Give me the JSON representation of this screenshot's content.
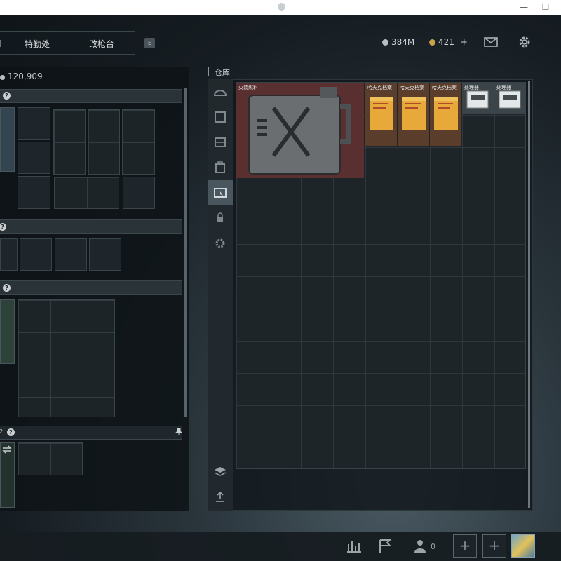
{
  "window": {
    "minimize_glyph": "—",
    "maximize_glyph": "☐"
  },
  "nav": {
    "tabs": [
      "特勤处",
      "改枪台"
    ],
    "hotkey": "E"
  },
  "header": {
    "silver": "384M",
    "gold": "421",
    "gold_add": "+",
    "icons": [
      "mail-icon",
      "gear-icon"
    ],
    "colors": {
      "silver": "#b9bec1",
      "gold": "#c9a24a"
    }
  },
  "loadout": {
    "money": "120,909",
    "help_glyph": "?",
    "last_section_prefix": "2",
    "pin_glyph": "📌"
  },
  "stash": {
    "title": "仓库",
    "items": [
      {
        "label": "火箭燃料",
        "kind": "jerrycan",
        "bg": "#5a2f2f"
      },
      {
        "label": "哈夫克档案",
        "kind": "folder",
        "bg": "#5b3d2c"
      },
      {
        "label": "哈夫克档案",
        "kind": "folder",
        "bg": "#5b3d2c"
      },
      {
        "label": "哈夫克档案",
        "kind": "folder",
        "bg": "#5b3d2c"
      },
      {
        "label": "处理器",
        "kind": "processor",
        "bg": "#3b4449"
      },
      {
        "label": "处理器",
        "kind": "processor",
        "bg": "#3b4449"
      }
    ],
    "sidebar_icons": [
      "helmet-icon",
      "armor-icon",
      "rig-icon",
      "backpack-icon",
      "case-icon",
      "lock-icon",
      "settings-icon",
      "layers-icon",
      "sort-icon"
    ]
  },
  "bottom": {
    "squad_count": "0",
    "add_glyph": "+",
    "icons": [
      "stats-icon",
      "flag-icon",
      "squad-icon"
    ]
  }
}
